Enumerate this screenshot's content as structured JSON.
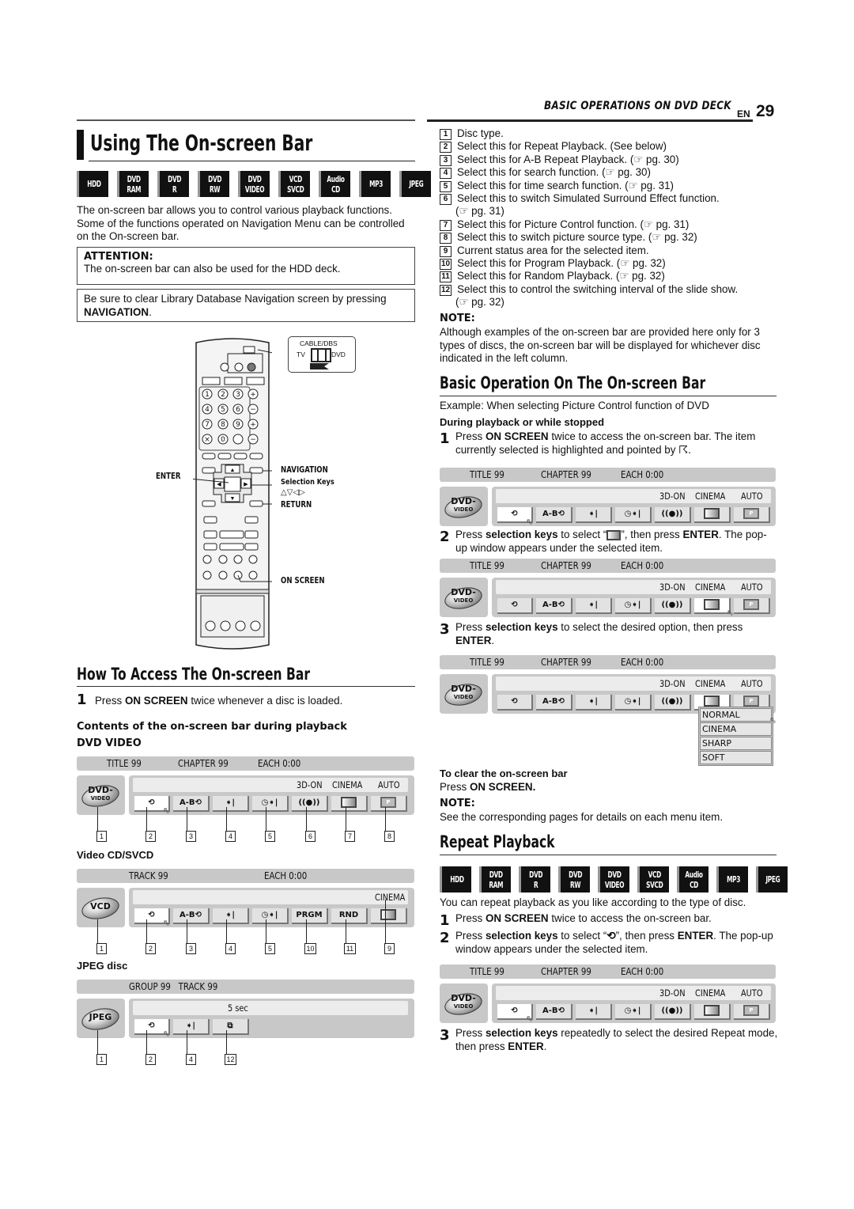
{
  "header": {
    "section": "BASIC OPERATIONS ON DVD DECK",
    "lang": "EN",
    "page": "29"
  },
  "main_title": "Using The On-screen Bar",
  "disc_badges": [
    {
      "line1": "HDD",
      "line2": ""
    },
    {
      "line1": "DVD",
      "line2": "RAM"
    },
    {
      "line1": "DVD",
      "line2": "R"
    },
    {
      "line1": "DVD",
      "line2": "RW"
    },
    {
      "line1": "DVD",
      "line2": "VIDEO"
    },
    {
      "line1": "VCD",
      "line2": "SVCD"
    },
    {
      "line1": "Audio",
      "line2": "CD"
    },
    {
      "line1": "MP3",
      "line2": ""
    },
    {
      "line1": "JPEG",
      "line2": ""
    }
  ],
  "intro": "The on-screen bar allows you to control various playback functions. Some of the functions operated on Navigation Menu can be controlled on the On-screen bar.",
  "attention": {
    "heading": "ATTENTION:",
    "text": "The on-screen bar can also be used for the HDD deck."
  },
  "notice": {
    "text": "Be sure to clear Library Database Navigation screen by pressing",
    "bold": "NAVIGATION",
    "suffix": "."
  },
  "remote": {
    "switch_label": "CABLE/DBS",
    "switch_left": "TV",
    "switch_right": "DVD",
    "labels": {
      "enter": "ENTER",
      "navigation": "NAVIGATION",
      "selection_keys": "Selection Keys",
      "arrows": "△▽◁▷",
      "return": "RETURN",
      "on_screen": "ON SCREEN"
    },
    "number_keys": [
      "1",
      "2",
      "3",
      "4",
      "5",
      "6",
      "7",
      "8",
      "9",
      "×",
      "0",
      ""
    ]
  },
  "how_to_access": {
    "title": "How To Access The On-screen Bar",
    "step1_num": "1",
    "step1_pre": "Press",
    "step1_bold": "ON SCREEN",
    "step1_post": "twice whenever a disc is loaded.",
    "contents_heading": "Contents of the on-screen bar during playback"
  },
  "bars": {
    "dvd_video": {
      "label": "DVD VIDEO",
      "info": [
        "TITLE 99",
        "CHAPTER 99",
        "EACH 0:00"
      ],
      "disc": "DVD-",
      "disc_sub": "VIDEO",
      "status": [
        "3D-ON",
        "CINEMA",
        "AUTO"
      ],
      "buttons": [
        "repeat",
        "A-B",
        "search",
        "time-search",
        "surround",
        "picture-control",
        "picture-source"
      ],
      "callouts": [
        "1",
        "2",
        "3",
        "4",
        "5",
        "6",
        "7",
        "8"
      ]
    },
    "vcd": {
      "label": "Video CD/SVCD",
      "info": [
        "TRACK 99",
        "EACH 0:00"
      ],
      "disc": "VCD",
      "status": [
        "CINEMA"
      ],
      "buttons_text": {
        "prgm": "PRGM",
        "rnd": "RND"
      },
      "callouts": [
        "1",
        "2",
        "3",
        "4",
        "5",
        "10",
        "11",
        "9"
      ]
    },
    "jpeg": {
      "label": "JPEG disc",
      "info": [
        "GROUP 99   TRACK 99"
      ],
      "disc": "JPEG",
      "status": [
        "5 sec"
      ],
      "callouts": [
        "1",
        "2",
        "4",
        "12"
      ]
    },
    "ab_label": "A-B"
  },
  "legend": [
    {
      "n": "1",
      "text": "Disc type."
    },
    {
      "n": "2",
      "text": "Select this for Repeat Playback. (See below)"
    },
    {
      "n": "3",
      "text": "Select this for A-B Repeat Playback. (☞ pg. 30)"
    },
    {
      "n": "4",
      "text": "Select this for search function. (☞ pg. 30)"
    },
    {
      "n": "5",
      "text": "Select this for time search function. (☞ pg. 31)"
    },
    {
      "n": "6",
      "text": "Select this to switch Simulated Surround Effect function.",
      "cont": "(☞ pg. 31)"
    },
    {
      "n": "7",
      "text": "Select this for Picture Control function. (☞ pg. 31)"
    },
    {
      "n": "8",
      "text": "Select this to switch picture source type. (☞ pg. 32)"
    },
    {
      "n": "9",
      "text": "Current status area for the selected item."
    },
    {
      "n": "10",
      "text": "Select this for Program Playback. (☞ pg. 32)"
    },
    {
      "n": "11",
      "text": "Select this for Random Playback. (☞ pg. 32)"
    },
    {
      "n": "12",
      "text": "Select this to control the switching interval of the slide show.",
      "cont": "(☞ pg. 32)"
    }
  ],
  "note1": {
    "heading": "NOTE:",
    "text": "Although examples of the on-screen bar are provided here only for 3 types of discs, the on-screen bar will be displayed for whichever disc indicated in the left column."
  },
  "basic_op": {
    "title": "Basic Operation On The On-screen Bar",
    "example": "Example: When selecting Picture Control function of DVD",
    "subhead": "During playback or while stopped",
    "step1": {
      "num": "1",
      "pre": "Press",
      "bold": "ON SCREEN",
      "post": "twice to access the on-screen bar. The item currently selected is highlighted and pointed by ☈."
    },
    "step2": {
      "num": "2",
      "pre": "Press",
      "bold": "selection keys",
      "mid": "to select “",
      "mid2": "”, then press",
      "bold2": "ENTER",
      "post": ". The pop-up window appears under the selected item."
    },
    "step3": {
      "num": "3",
      "pre": "Press",
      "bold": "selection keys",
      "post": "to select the desired option, then press",
      "bold2": "ENTER",
      "end": "."
    },
    "popup_options": [
      "NORMAL",
      "CINEMA",
      "SHARP",
      "SOFT"
    ],
    "clear_heading": "To clear the on-screen bar",
    "clear_pre": "Press",
    "clear_bold": "ON SCREEN.",
    "note_heading": "NOTE:",
    "note_text": "See the corresponding pages for details on each menu item."
  },
  "repeat": {
    "title": "Repeat Playback",
    "intro": "You can repeat playback as you like according to the type of disc.",
    "step1": {
      "num": "1",
      "pre": "Press",
      "bold": "ON SCREEN",
      "post": "twice to access the on-screen bar."
    },
    "step2": {
      "num": "2",
      "pre": "Press",
      "bold": "selection keys",
      "mid": "to select “",
      "mid2": "”, then press",
      "bold2": "ENTER",
      "post": ". The pop-up window appears under the selected item."
    },
    "step3": {
      "num": "3",
      "pre": "Press",
      "bold": "selection keys",
      "post": "repeatedly to select the desired Repeat mode, then press",
      "bold2": "ENTER",
      "end": "."
    }
  }
}
